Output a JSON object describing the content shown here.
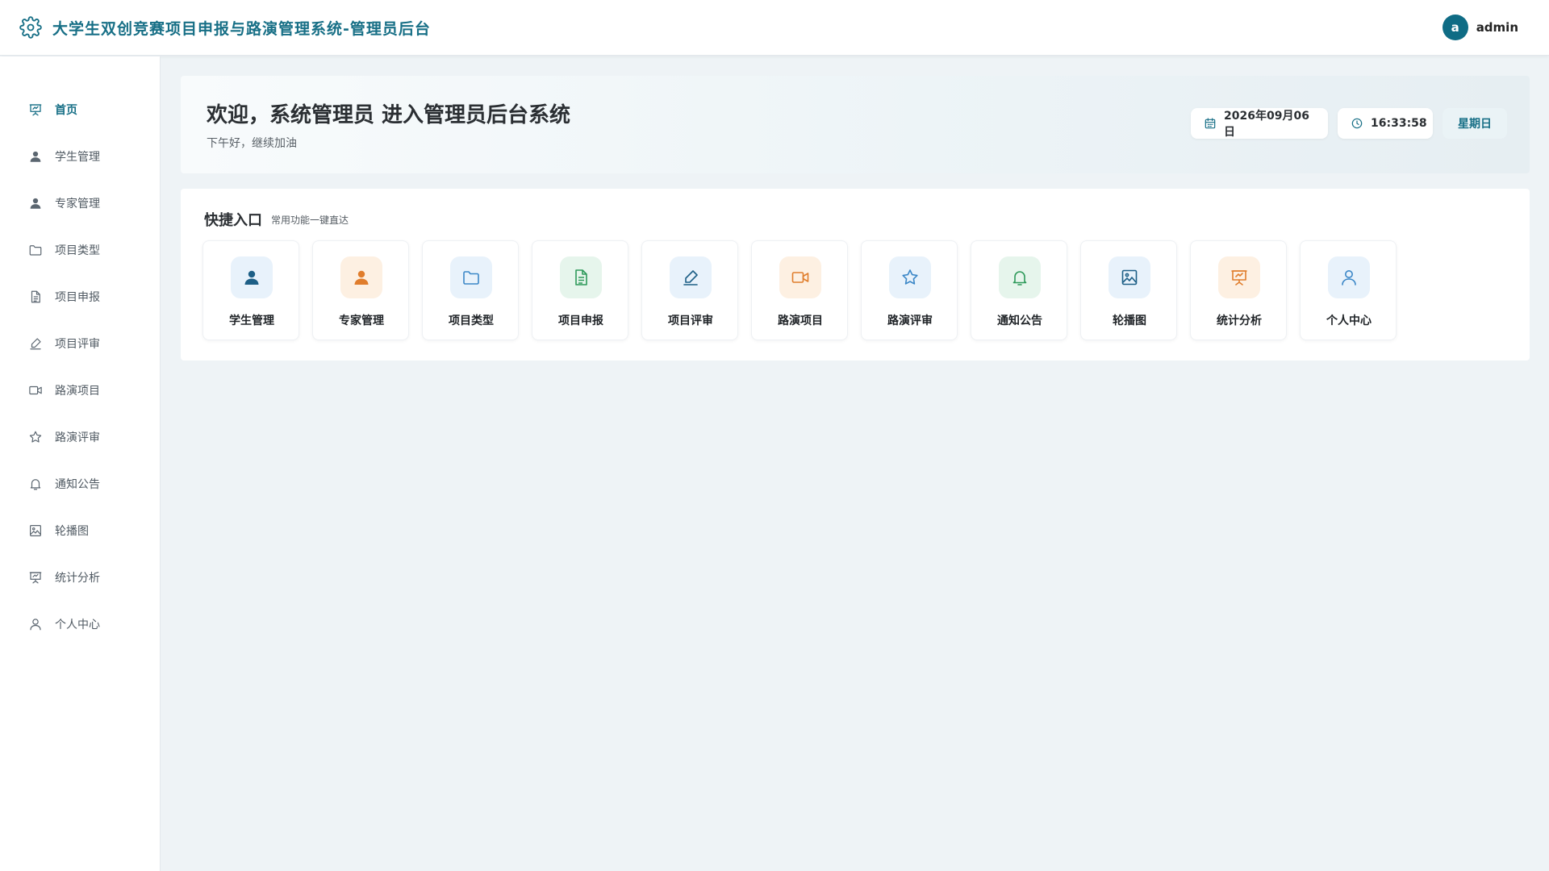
{
  "header": {
    "title": "大学生双创竞赛项目申报与路演管理系统-管理员后台",
    "logo_icon": "gear-icon",
    "user": {
      "avatar_letter": "a",
      "name": "admin"
    }
  },
  "sidebar": {
    "items": [
      {
        "label": "首页",
        "icon": "presentation-icon",
        "active": true
      },
      {
        "label": "学生管理",
        "icon": "user-solid-icon"
      },
      {
        "label": "专家管理",
        "icon": "user-solid-icon"
      },
      {
        "label": "项目类型",
        "icon": "folder-icon"
      },
      {
        "label": "项目申报",
        "icon": "document-icon"
      },
      {
        "label": "项目评审",
        "icon": "pen-icon"
      },
      {
        "label": "路演项目",
        "icon": "video-icon"
      },
      {
        "label": "路演评审",
        "icon": "star-icon"
      },
      {
        "label": "通知公告",
        "icon": "bell-icon"
      },
      {
        "label": "轮播图",
        "icon": "image-icon"
      },
      {
        "label": "统计分析",
        "icon": "presentation-icon"
      },
      {
        "label": "个人中心",
        "icon": "user-outline-icon"
      }
    ]
  },
  "welcome": {
    "title": "欢迎，系统管理员 进入管理员后台系统",
    "subtitle": "下午好，继续加油",
    "date": "2026年09月06日",
    "time": "16:33:58",
    "weekday": "星期日"
  },
  "quick_entry": {
    "title": "快捷入口",
    "subtitle": "常用功能一键直达",
    "tiles": [
      {
        "label": "学生管理",
        "icon": "user-solid-icon",
        "color": "#1d5f86"
      },
      {
        "label": "专家管理",
        "icon": "user-solid-icon",
        "color": "#e07d2c"
      },
      {
        "label": "项目类型",
        "icon": "folder-icon",
        "color": "#3b87c7"
      },
      {
        "label": "项目申报",
        "icon": "document-icon",
        "color": "#2e9a5a"
      },
      {
        "label": "项目评审",
        "icon": "pen-icon",
        "color": "#1d5f86"
      },
      {
        "label": "路演项目",
        "icon": "video-icon",
        "color": "#e07d2c"
      },
      {
        "label": "路演评审",
        "icon": "star-icon",
        "color": "#3b87c7"
      },
      {
        "label": "通知公告",
        "icon": "bell-icon",
        "color": "#2e9a5a"
      },
      {
        "label": "轮播图",
        "icon": "image-icon",
        "color": "#1d5f86"
      },
      {
        "label": "统计分析",
        "icon": "presentation-icon",
        "color": "#e07d2c"
      },
      {
        "label": "个人中心",
        "icon": "user-outline-icon",
        "color": "#3b87c7"
      }
    ]
  },
  "colors": {
    "brand": "#176f86",
    "page_bg": "#eef3f6",
    "sidebar_icon": "#5b6670"
  }
}
